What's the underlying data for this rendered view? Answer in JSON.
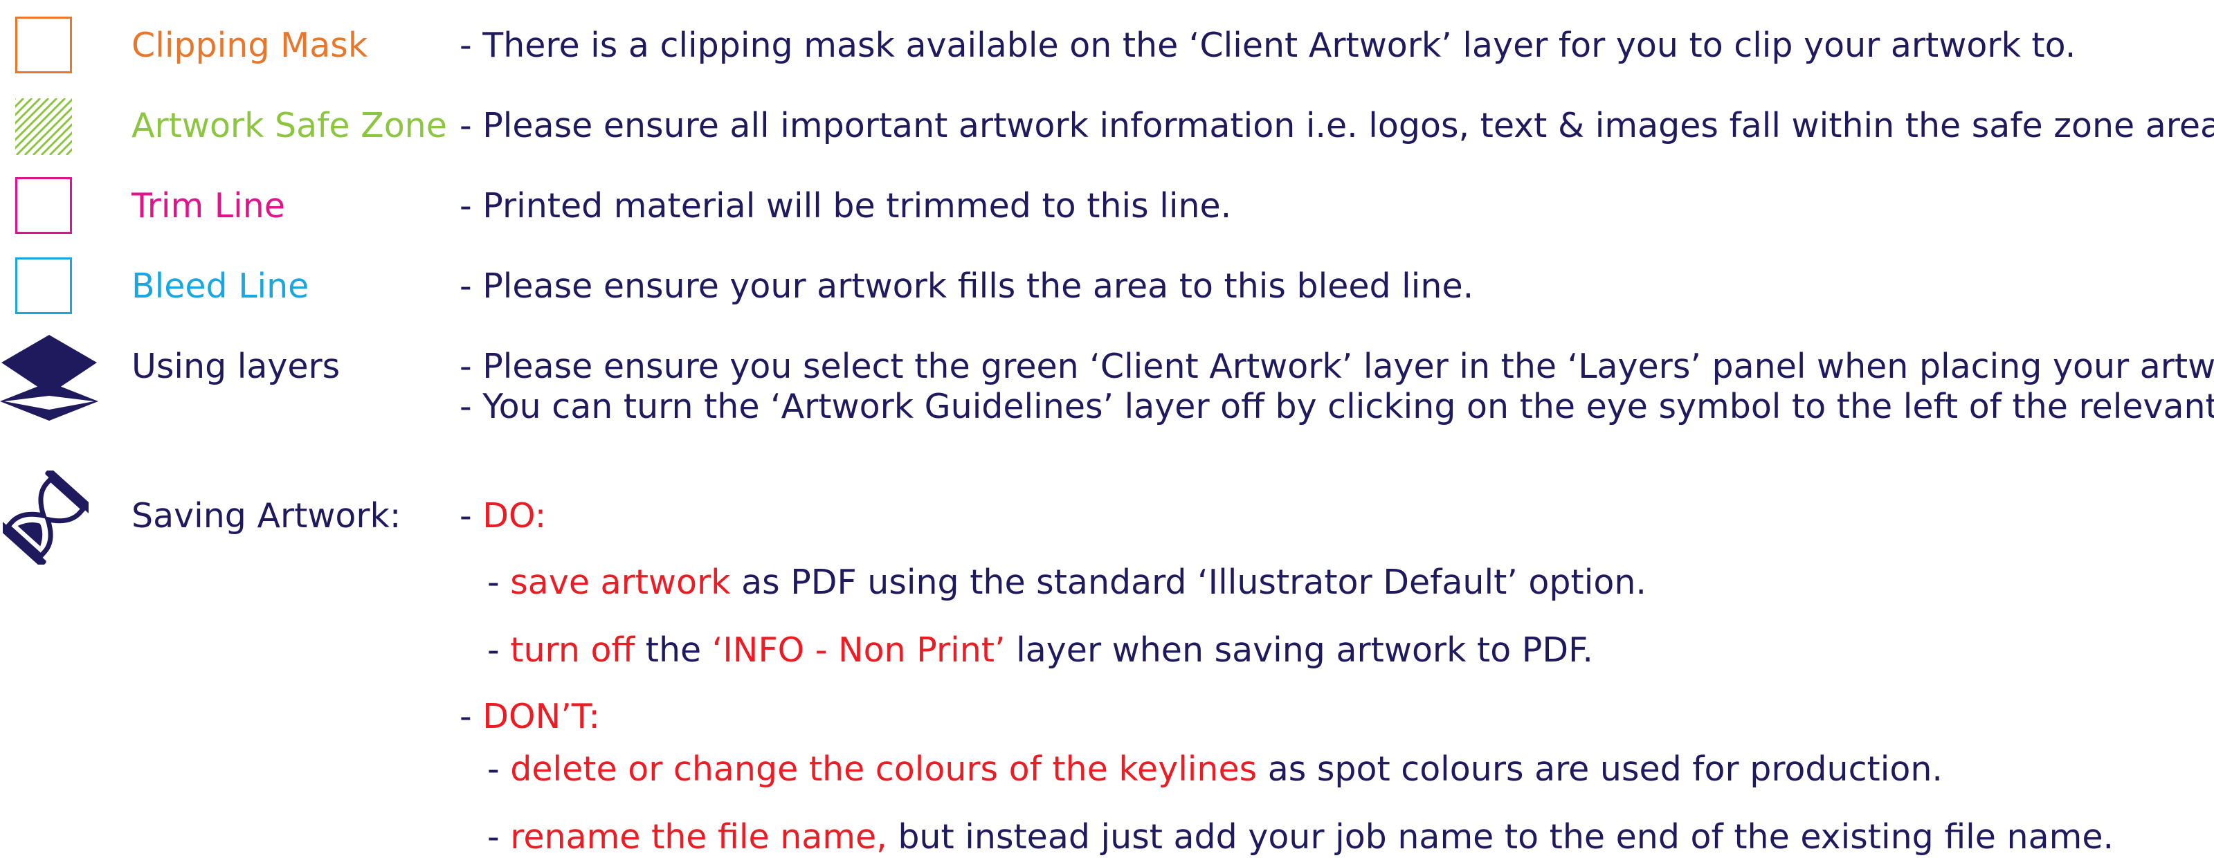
{
  "colors": {
    "navy": "#1f1a5e",
    "orange": "#e8762b",
    "green": "#8cc63f",
    "magenta": "#e2128b",
    "cyan": "#1aa7e0",
    "red": "#ec1c24"
  },
  "legend": [
    {
      "icon": "clipping-mask-icon",
      "label": "Clipping Mask",
      "description": "- There is a clipping mask available on the ‘Client Artwork’ layer for you to clip your artwork to."
    },
    {
      "icon": "safe-zone-hatch-icon",
      "label": "Artwork Safe Zone",
      "description": "-  Please ensure all important artwork information i.e. logos, text & images fall within the safe zone area."
    },
    {
      "icon": "trim-line-icon",
      "label": "Trim Line",
      "description": "-  Printed material will be trimmed to this line."
    },
    {
      "icon": "bleed-line-icon",
      "label": "Bleed Line",
      "description": "-  Please ensure your artwork fills the area to this bleed line."
    }
  ],
  "layers": {
    "icon": "layers-icon",
    "label": "Using layers",
    "lines": [
      "-  Please ensure you select the green ‘Client Artwork’ layer in the ‘Layers’ panel when placing your artwork.",
      "-  You can turn the ‘Artwork Guidelines’  layer off by clicking on the eye symbol to the left of the relevant layer."
    ]
  },
  "saving": {
    "icon": "hourglass-icon",
    "label": "Saving Artwork:",
    "do": {
      "prefix": "-  ",
      "heading": "DO:",
      "items": [
        {
          "prefix": "-  ",
          "highlight": "save artwork",
          "rest": " as PDF using the standard ‘Illustrator Default’ option."
        },
        {
          "prefix": "-  ",
          "highlight": "turn off",
          "middle": " the ",
          "highlight2": "‘INFO - Non Print’",
          "rest": " layer when saving artwork to PDF."
        }
      ]
    },
    "dont": {
      "prefix": "-  ",
      "heading": "DON’T:",
      "items": [
        {
          "prefix": "-  ",
          "highlight": "delete or change the colours of the keylines",
          "rest": " as spot colours are used for production."
        },
        {
          "prefix": "-  ",
          "highlight": "rename the file name,",
          "rest": " but instead just add your job name to the end of the existing file name."
        }
      ]
    }
  }
}
